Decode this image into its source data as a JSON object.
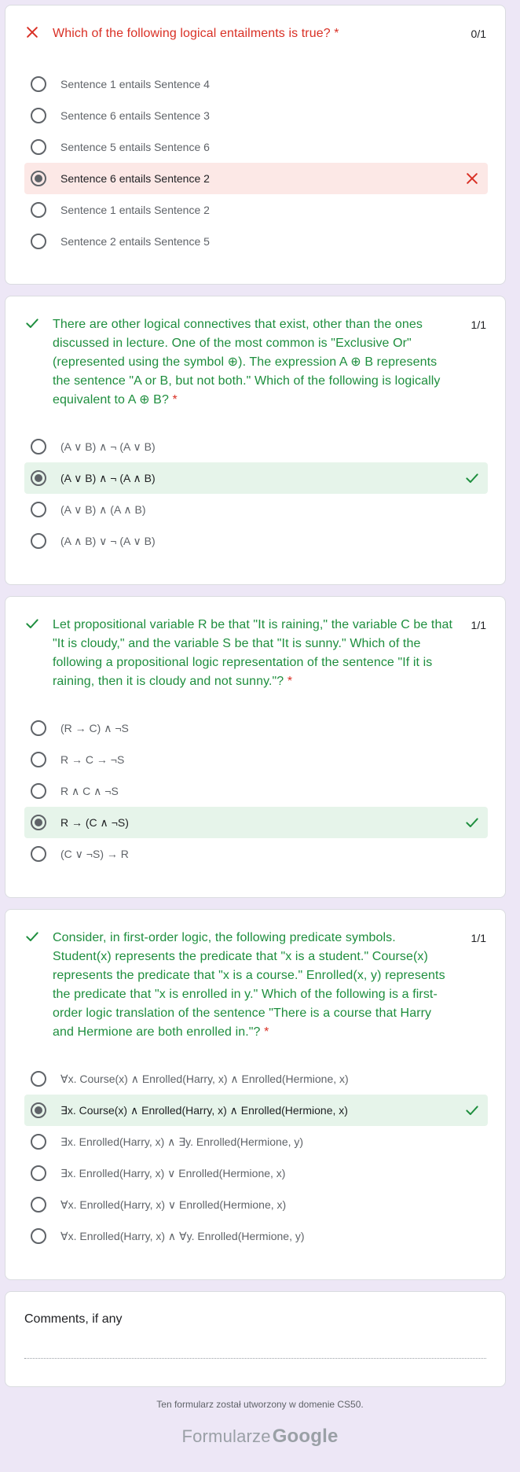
{
  "questions": [
    {
      "text": "Which of the following logical entailments is true?",
      "required_mark": "*",
      "score": "0/1",
      "status": "incorrect",
      "options": [
        "Sentence 1 entails Sentence 4",
        "Sentence 6 entails Sentence 3",
        "Sentence 5 entails Sentence 6",
        "Sentence 6 entails Sentence 2",
        "Sentence 1 entails Sentence 2",
        "Sentence 2 entails Sentence 5"
      ],
      "selected_index": 3
    },
    {
      "text": "There are other logical connectives that exist, other than the ones discussed in lecture. One of the most common is \"Exclusive Or\" (represented using the symbol ⊕). The expression A ⊕ B represents the sentence \"A or B, but not both.\" Which of the following is logically equivalent to A ⊕ B?",
      "required_mark": "*",
      "score": "1/1",
      "status": "correct",
      "options": [
        "(A ∨ B) ∧ ¬ (A ∨ B)",
        "(A ∨ B) ∧ ¬ (A ∧ B)",
        "(A ∨ B) ∧ (A ∧ B)",
        "(A ∧ B) ∨ ¬ (A ∨ B)"
      ],
      "selected_index": 1
    },
    {
      "text": "Let propositional variable R be that \"It is raining,\" the variable C be that \"It is cloudy,\" and the variable S be that \"It is sunny.\" Which of the following a propositional logic representation of the sentence \"If it is raining, then it is cloudy and not sunny.\"?",
      "required_mark": "*",
      "score": "1/1",
      "status": "correct",
      "options": [
        "(R → C) ∧ ¬S",
        "R → C → ¬S",
        "R ∧ C ∧ ¬S",
        "R → (C ∧ ¬S)",
        "(C ∨ ¬S) → R"
      ],
      "selected_index": 3
    },
    {
      "text": "Consider, in first-order logic, the following predicate symbols. Student(x) represents the predicate that \"x is a student.\" Course(x) represents the predicate that \"x is a course.\" Enrolled(x, y) represents the predicate that \"x is enrolled in y.\" Which of the following is a first-order logic translation of the sentence \"There is a course that Harry and Hermione are both enrolled in.\"?",
      "required_mark": "*",
      "score": "1/1",
      "status": "correct",
      "options": [
        "∀x. Course(x) ∧ Enrolled(Harry, x) ∧ Enrolled(Hermione, x)",
        "∃x. Course(x) ∧ Enrolled(Harry, x) ∧ Enrolled(Hermione, x)",
        "∃x. Enrolled(Harry, x) ∧ ∃y. Enrolled(Hermione, y)",
        "∃x. Enrolled(Harry, x) ∨ Enrolled(Hermione, x)",
        "∀x. Enrolled(Harry, x) ∨ Enrolled(Hermione, x)",
        "∀x. Enrolled(Harry, x) ∧ ∀y. Enrolled(Hermione, y)"
      ],
      "selected_index": 1
    }
  ],
  "comments": {
    "title": "Comments, if any"
  },
  "footer": {
    "note": "Ten formularz został utworzony w domenie CS50.",
    "brand_prefix": "Formularze",
    "brand_name": "Google"
  },
  "colors": {
    "incorrect": "#d93025",
    "correct": "#1e8e3e",
    "incorrect_bg": "#fce8e6",
    "correct_bg": "#e6f4ea",
    "page_bg": "#ede7f6"
  },
  "icons": {
    "incorrect": "close-icon",
    "correct": "check-icon"
  }
}
